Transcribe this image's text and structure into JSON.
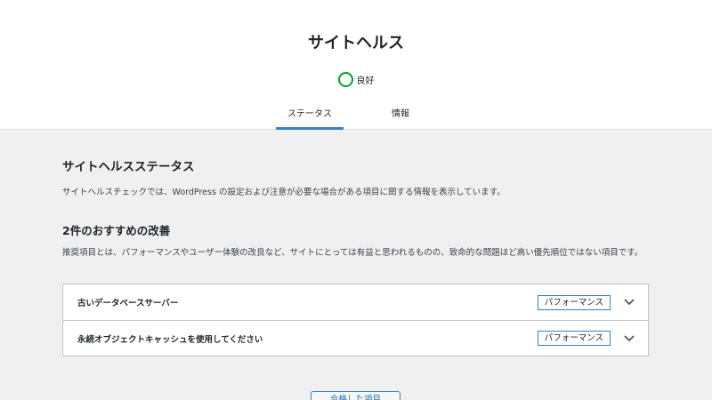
{
  "header": {
    "title": "サイトヘルス",
    "status_text": "良好",
    "status_color": "#00a32a"
  },
  "tabs": [
    {
      "label": "ステータス",
      "active": true
    },
    {
      "label": "情報",
      "active": false
    }
  ],
  "main": {
    "section_title": "サイトヘルスステータス",
    "section_desc": "サイトヘルスチェックでは、WordPress の設定および注意が必要な場合がある項目に関する情報を表示しています。",
    "recommendations_title": "2件のおすすめの改善",
    "recommendations_desc": "推奨項目とは、パフォーマンスやユーザー体験の改良など、サイトにとっては有益と思われるものの、致命的な問題ほど高い優先順位ではない項目です。",
    "items": [
      {
        "title": "古いデータベースサーバー",
        "badge": "パフォーマンス"
      },
      {
        "title": "永続オブジェクトキャッシュを使用してください",
        "badge": "パフォーマンス"
      }
    ],
    "passed_button": "合格した項目"
  },
  "colors": {
    "accent": "#3582c4",
    "good": "#00a32a"
  }
}
